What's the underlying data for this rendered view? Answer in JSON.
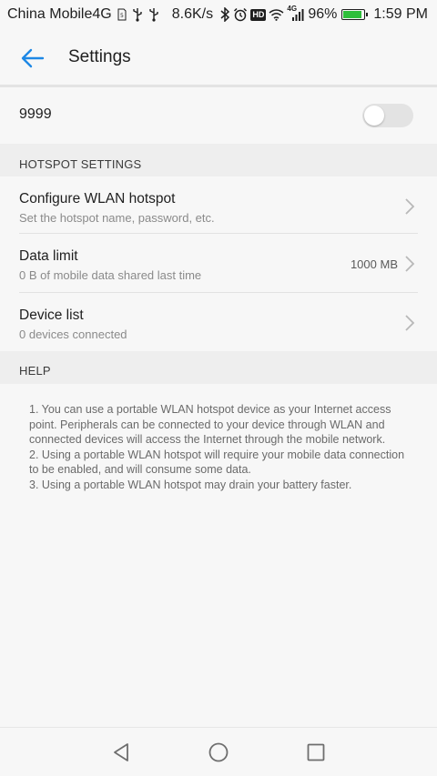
{
  "status_bar": {
    "carrier": "China Mobile4G",
    "network_speed": "8.6K/s",
    "network_type": "4G",
    "hd_badge": "HD",
    "battery_percent": "96%",
    "battery_level": 0.96,
    "time": "1:59 PM",
    "icons": [
      "sim-icon",
      "usb-icon",
      "usb-icon",
      "bluetooth-icon",
      "alarm-icon",
      "hd-icon",
      "wifi-icon",
      "signal-icon",
      "battery-icon"
    ]
  },
  "app_bar": {
    "back_icon": "arrow-left-icon",
    "title": "Settings"
  },
  "hotspot": {
    "name": "9999",
    "enabled": false
  },
  "sections": {
    "hotspot_settings": "HOTSPOT SETTINGS",
    "help": "HELP"
  },
  "items": [
    {
      "title": "Configure WLAN hotspot",
      "subtitle": "Set the hotspot name, password, etc.",
      "value": ""
    },
    {
      "title": "Data limit",
      "subtitle": "0 B of mobile data shared last time",
      "value": "1000 MB"
    },
    {
      "title": "Device list",
      "subtitle": "0 devices connected",
      "value": ""
    }
  ],
  "help": {
    "paragraphs": [
      "1. You can use a portable WLAN hotspot device as your Internet access point. Peripherals can be connected to your device through WLAN and connected devices will access the Internet through the mobile network.",
      "2. Using a portable WLAN hotspot will require your mobile data connection to be enabled, and will consume some data.",
      "3. Using a portable WLAN hotspot may drain your battery faster."
    ]
  },
  "nav_bar": {
    "buttons": [
      "back-triangle-icon",
      "home-circle-icon",
      "recents-square-icon"
    ]
  },
  "colors": {
    "accent": "#1e88e5",
    "background": "#f7f7f7",
    "section_background": "#eeeeee",
    "switch_off": "#e3e3e3",
    "battery_fill": "#2fbf3b"
  }
}
